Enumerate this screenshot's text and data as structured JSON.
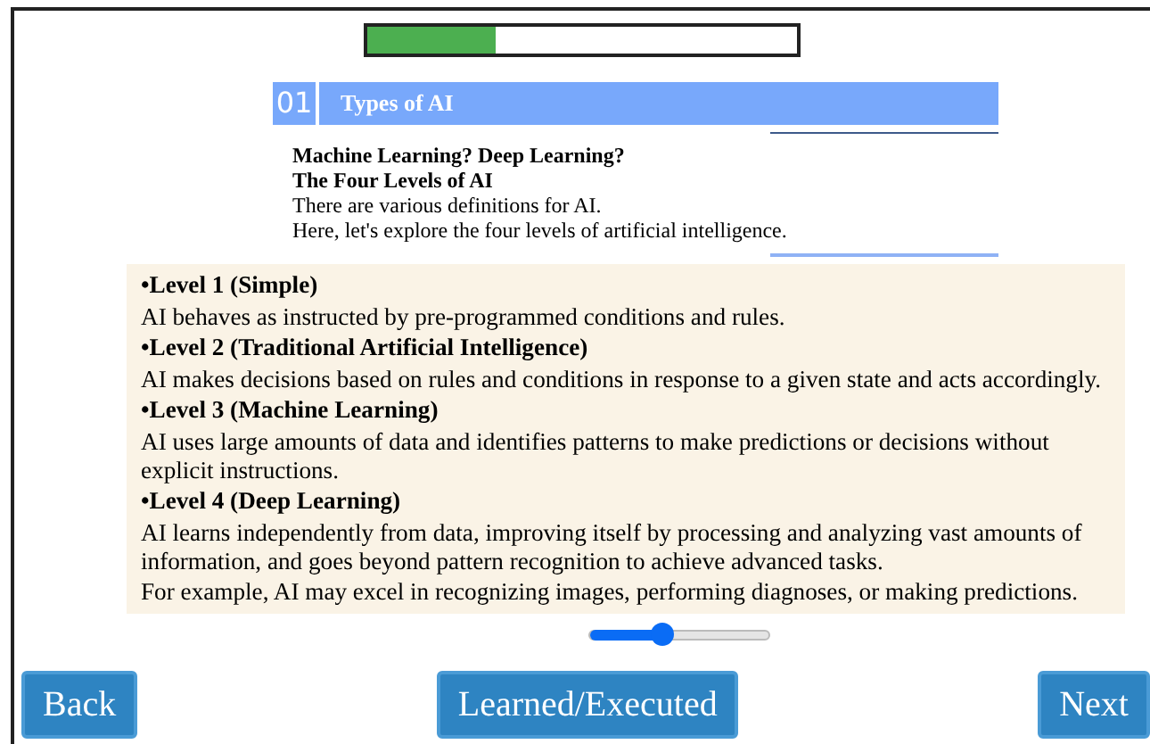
{
  "progress": {
    "level": 0.3
  },
  "section": {
    "number": "01",
    "title": "Types of AI"
  },
  "intro": {
    "headings": [
      "Machine Learning? Deep Learning?",
      "The Four Levels of AI"
    ],
    "lines": [
      "There are various definitions for AI.",
      "Here, let's explore the four levels of artificial intelligence."
    ]
  },
  "levels": [
    {
      "heading": "•Level 1 (Simple)",
      "text": "AI behaves as instructed by pre-programmed conditions and rules."
    },
    {
      "heading": "•Level 2 (Traditional Artificial Intelligence)",
      "text": "AI makes decisions based on rules and conditions in response to a given state and acts accordingly."
    },
    {
      "heading": "•Level 3 (Machine Learning)",
      "text": "AI uses large amounts of data and identifies patterns to make predictions or decisions without explicit instructions."
    },
    {
      "heading": "•Level 4 (Deep Learning)",
      "text": "AI learns independently from data, improving itself by processing and analyzing vast amounts of information, and goes beyond pattern recognition to achieve advanced tasks."
    }
  ],
  "note": "For example, AI may excel in recognizing images, performing diagnoses, or making predictions.",
  "slider": {
    "level": 0.4
  },
  "buttons": [
    "Back",
    "Learned/Executed",
    "Next"
  ]
}
